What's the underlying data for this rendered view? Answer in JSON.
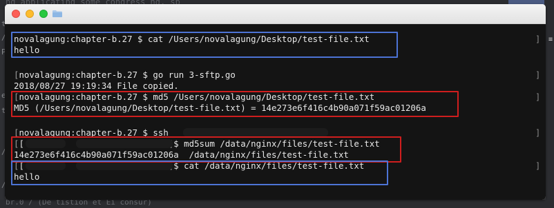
{
  "background": {
    "top_text": "ng applicating some congress ng, sp",
    "gutter_chars": [
      "t",
      "/",
      "P",
      "e",
      "t",
      "/",
      "/"
    ],
    "bottom_text": "br.0 / (De tistion et Ei consur)"
  },
  "terminal": {
    "prompt": "novalagung:chapter-b.27 $ ",
    "lines": [
      {
        "bracket": "",
        "text": "novalagung:chapter-b.27 $ cat /Users/novalagung/Desktop/test-file.txt"
      },
      {
        "bracket": "",
        "text": "hello"
      },
      {
        "bracket": "[",
        "text": "novalagung:chapter-b.27 $ go run 3-sftp.go"
      },
      {
        "bracket": "",
        "text": "2018/08/27 19:19:34 File copied."
      },
      {
        "bracket": "[",
        "text": "novalagung:chapter-b.27 $ md5 /Users/novalagung/Desktop/test-file.txt"
      },
      {
        "bracket": "",
        "text": "MD5 (/Users/novalagung/Desktop/test-file.txt) = 14e273e6f416c4b90a071f59ac01206a"
      },
      {
        "bracket": "[",
        "text": "novalagung:chapter-b.27 $ ssh"
      },
      {
        "bracket": "[",
        "text": "[           @i              ~]$ md5sum /data/nginx/files/test-file.txt"
      },
      {
        "bracket": "",
        "text": "14e273e6f416c4b90a071f59ac01206a  /data/nginx/files/test-file.txt"
      },
      {
        "bracket": "[",
        "text": "[           @i              ~]$ cat /data/nginx/files/test-file.txt"
      },
      {
        "bracket": "",
        "text": "hello"
      }
    ],
    "right_marks": [
      "]",
      "]",
      "]",
      "]",
      "]"
    ]
  },
  "colors": {
    "terminal_bg": "#141414",
    "text": "#e8e8e8",
    "highlight_blue": "#4d74d6",
    "highlight_red": "#d01e1e"
  }
}
